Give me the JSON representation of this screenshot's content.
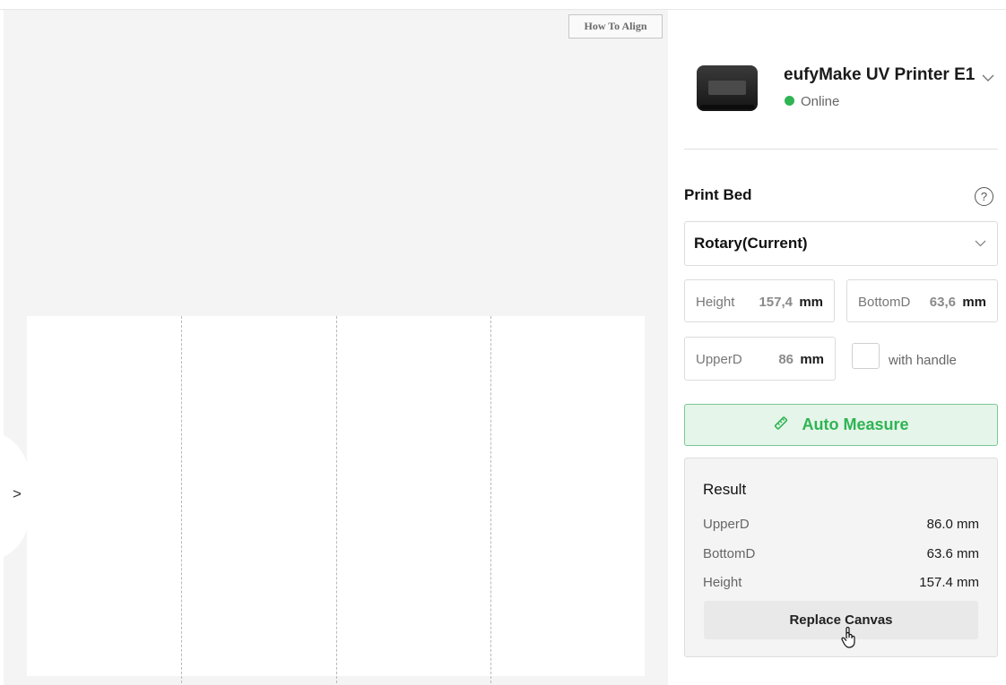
{
  "canvas": {
    "how_to_align_label": "How To Align",
    "expand_arrow": ">"
  },
  "printer": {
    "name": "eufyMake UV Printer E1",
    "status": "Online",
    "status_color": "#2fb454",
    "thumbnail_icon": "printer-device-image",
    "caret_icon": "chevron-down-icon"
  },
  "print_bed": {
    "title": "Print Bed",
    "help_icon": "?",
    "selected": "Rotary(Current)",
    "caret": "∨"
  },
  "dimensions": {
    "height": {
      "label": "Height",
      "value": "157,4",
      "unit": "mm"
    },
    "bottom": {
      "label": "BottomD",
      "value": "63,6",
      "unit": "mm"
    },
    "upper": {
      "label": "UpperD",
      "value": "86",
      "unit": "mm"
    },
    "with_handle": {
      "label": "with handle",
      "checked": false
    }
  },
  "auto_measure": {
    "label": "Auto Measure",
    "icon": "ruler-pencil-icon",
    "color": "#2fb454"
  },
  "result": {
    "title": "Result",
    "rows": [
      {
        "key": "UpperD",
        "value": "86.0 mm"
      },
      {
        "key": "BottomD",
        "value": "63.6 mm"
      },
      {
        "key": "Height",
        "value": "157.4 mm"
      }
    ],
    "replace_label": "Replace Canvas"
  }
}
